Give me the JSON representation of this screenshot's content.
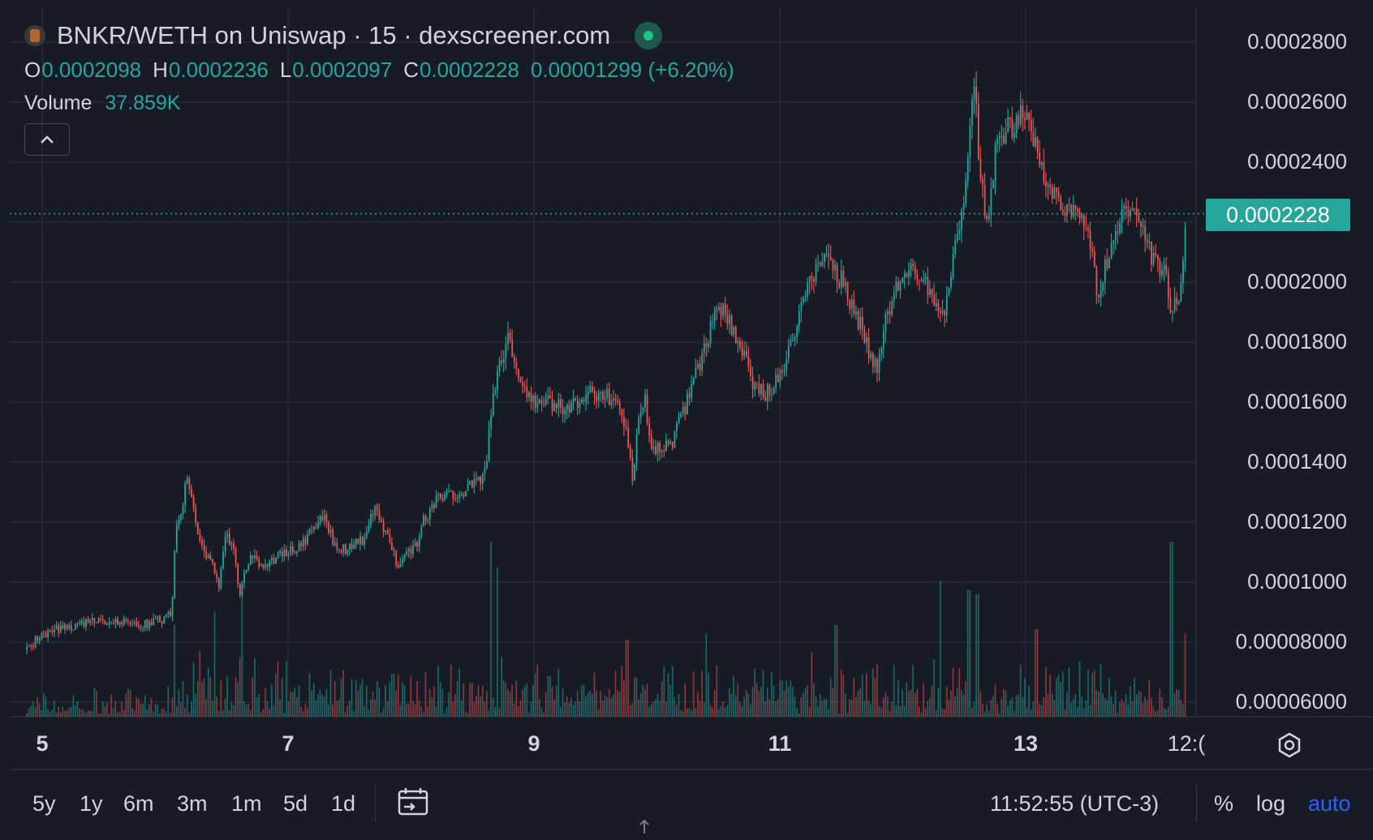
{
  "header": {
    "title": "BNKR/WETH on Uniswap · 15 · dexscreener.com",
    "ohlc": [
      {
        "key": "O",
        "value": "0.0002098"
      },
      {
        "key": "H",
        "value": "0.0002236"
      },
      {
        "key": "L",
        "value": "0.0002097"
      },
      {
        "key": "C",
        "value": "0.0002228"
      }
    ],
    "change": "0.00001299 (+6.20%)",
    "volume_label": "Volume",
    "volume_value": "37.859K"
  },
  "colors": {
    "up": "#26a69a",
    "down": "#ef5350",
    "background": "#171b26",
    "grid": "#262a36",
    "accent_blue": "#2962ff"
  },
  "price_axis": {
    "labels": [
      "0.0002800",
      "0.0002600",
      "0.0002400",
      "0.0002000",
      "0.0001800",
      "0.0001600",
      "0.0001400",
      "0.0001200",
      "0.0001000",
      "0.00008000",
      "0.00006000"
    ],
    "current_price": "0.0002228"
  },
  "time_axis": {
    "labels": [
      "5",
      "7",
      "9",
      "11",
      "13",
      "12:("
    ]
  },
  "bottom_bar": {
    "ranges": [
      "5y",
      "1y",
      "6m",
      "3m",
      "1m",
      "5d",
      "1d"
    ],
    "time": "11:52:55 (UTC-3)",
    "options": [
      "%",
      "log",
      "auto"
    ]
  },
  "chart_data": {
    "type": "candlestick",
    "title": "BNKR/WETH on Uniswap · 15 · dexscreener.com",
    "x_tick_labels": [
      "5",
      "7",
      "9",
      "11",
      "13",
      "12:("
    ],
    "y_tick_labels": [
      "0.0002800",
      "0.0002600",
      "0.0002400",
      "0.0002000",
      "0.0001800",
      "0.0001600",
      "0.0001400",
      "0.0001200",
      "0.0001000",
      "0.00008000",
      "0.00006000"
    ],
    "y_range": [
      5.75e-05,
      0.0002865
    ],
    "x_range_days": [
      4.85,
      14.3
    ],
    "current_price": 0.0002228,
    "grid": true,
    "price_path": [
      {
        "day": 4.87,
        "price": 7.73e-05
      },
      {
        "day": 4.95,
        "price": 8.12e-05
      },
      {
        "day": 5.1,
        "price": 8.42e-05
      },
      {
        "day": 5.3,
        "price": 8.6e-05
      },
      {
        "day": 5.5,
        "price": 8.72e-05
      },
      {
        "day": 5.7,
        "price": 8.62e-05
      },
      {
        "day": 5.85,
        "price": 8.6e-05
      },
      {
        "day": 5.97,
        "price": 8.75e-05
      },
      {
        "day": 6.05,
        "price": 8.92e-05
      },
      {
        "day": 6.08,
        "price": 0.000119
      },
      {
        "day": 6.13,
        "price": 0.000125
      },
      {
        "day": 6.17,
        "price": 0.0001345
      },
      {
        "day": 6.22,
        "price": 0.0001255
      },
      {
        "day": 6.3,
        "price": 0.00011
      },
      {
        "day": 6.37,
        "price": 0.000106
      },
      {
        "day": 6.43,
        "price": 9.9e-05
      },
      {
        "day": 6.48,
        "price": 0.000117
      },
      {
        "day": 6.55,
        "price": 0.00011
      },
      {
        "day": 6.6,
        "price": 9.6e-05
      },
      {
        "day": 6.68,
        "price": 0.000108
      },
      {
        "day": 6.8,
        "price": 0.000106
      },
      {
        "day": 6.95,
        "price": 0.000109
      },
      {
        "day": 7.1,
        "price": 0.000112
      },
      {
        "day": 7.2,
        "price": 0.000118
      },
      {
        "day": 7.3,
        "price": 0.000122
      },
      {
        "day": 7.35,
        "price": 0.000114
      },
      {
        "day": 7.45,
        "price": 0.000111
      },
      {
        "day": 7.6,
        "price": 0.000114
      },
      {
        "day": 7.7,
        "price": 0.000124
      },
      {
        "day": 7.8,
        "price": 0.000115
      },
      {
        "day": 7.88,
        "price": 0.000106
      },
      {
        "day": 7.95,
        "price": 0.00011
      },
      {
        "day": 8.05,
        "price": 0.000113
      },
      {
        "day": 8.1,
        "price": 0.000121
      },
      {
        "day": 8.2,
        "price": 0.000127
      },
      {
        "day": 8.35,
        "price": 0.00013
      },
      {
        "day": 8.5,
        "price": 0.000132
      },
      {
        "day": 8.6,
        "price": 0.000136
      },
      {
        "day": 8.65,
        "price": 0.00016
      },
      {
        "day": 8.72,
        "price": 0.000172
      },
      {
        "day": 8.78,
        "price": 0.0001835
      },
      {
        "day": 8.85,
        "price": 0.00017
      },
      {
        "day": 8.92,
        "price": 0.000166
      },
      {
        "day": 9.0,
        "price": 0.000159
      },
      {
        "day": 9.1,
        "price": 0.00016
      },
      {
        "day": 9.25,
        "price": 0.000158
      },
      {
        "day": 9.35,
        "price": 0.00016
      },
      {
        "day": 9.42,
        "price": 0.000164
      },
      {
        "day": 9.5,
        "price": 0.000161
      },
      {
        "day": 9.6,
        "price": 0.000162
      },
      {
        "day": 9.7,
        "price": 0.000158
      },
      {
        "day": 9.75,
        "price": 0.000148
      },
      {
        "day": 9.8,
        "price": 0.000134
      },
      {
        "day": 9.85,
        "price": 0.000156
      },
      {
        "day": 9.9,
        "price": 0.00016
      },
      {
        "day": 9.95,
        "price": 0.000144
      },
      {
        "day": 10.05,
        "price": 0.000145
      },
      {
        "day": 10.12,
        "price": 0.000147
      },
      {
        "day": 10.2,
        "price": 0.000155
      },
      {
        "day": 10.3,
        "price": 0.000168
      },
      {
        "day": 10.4,
        "price": 0.00018
      },
      {
        "day": 10.47,
        "price": 0.000193
      },
      {
        "day": 10.55,
        "price": 0.00019
      },
      {
        "day": 10.62,
        "price": 0.000183
      },
      {
        "day": 10.7,
        "price": 0.000176
      },
      {
        "day": 10.78,
        "price": 0.000164
      },
      {
        "day": 10.88,
        "price": 0.000163
      },
      {
        "day": 11.0,
        "price": 0.000169
      },
      {
        "day": 11.1,
        "price": 0.000182
      },
      {
        "day": 11.2,
        "price": 0.000196
      },
      {
        "day": 11.3,
        "price": 0.000206
      },
      {
        "day": 11.4,
        "price": 0.000207
      },
      {
        "day": 11.5,
        "price": 0.0002
      },
      {
        "day": 11.6,
        "price": 0.000191
      },
      {
        "day": 11.7,
        "price": 0.00018
      },
      {
        "day": 11.78,
        "price": 0.00017
      },
      {
        "day": 11.85,
        "price": 0.000186
      },
      {
        "day": 11.95,
        "price": 0.0002
      },
      {
        "day": 12.05,
        "price": 0.000206
      },
      {
        "day": 12.15,
        "price": 0.000202
      },
      {
        "day": 12.25,
        "price": 0.000191
      },
      {
        "day": 12.35,
        "price": 0.000192
      },
      {
        "day": 12.42,
        "price": 0.00021
      },
      {
        "day": 12.5,
        "price": 0.000229
      },
      {
        "day": 12.55,
        "price": 0.000255
      },
      {
        "day": 12.58,
        "price": 0.000266
      },
      {
        "day": 12.62,
        "price": 0.000236
      },
      {
        "day": 12.68,
        "price": 0.000218
      },
      {
        "day": 12.75,
        "price": 0.000245
      },
      {
        "day": 12.8,
        "price": 0.00025
      },
      {
        "day": 12.9,
        "price": 0.000253
      },
      {
        "day": 13.0,
        "price": 0.000257
      },
      {
        "day": 13.05,
        "price": 0.000246
      },
      {
        "day": 13.12,
        "price": 0.00024
      },
      {
        "day": 13.2,
        "price": 0.00023
      },
      {
        "day": 13.3,
        "price": 0.000226
      },
      {
        "day": 13.4,
        "price": 0.000225
      },
      {
        "day": 13.5,
        "price": 0.000216
      },
      {
        "day": 13.58,
        "price": 0.000196
      },
      {
        "day": 13.65,
        "price": 0.000206
      },
      {
        "day": 13.72,
        "price": 0.000214
      },
      {
        "day": 13.8,
        "price": 0.000224
      },
      {
        "day": 13.9,
        "price": 0.000221
      },
      {
        "day": 13.98,
        "price": 0.000212
      },
      {
        "day": 14.05,
        "price": 0.000206
      },
      {
        "day": 14.12,
        "price": 0.000205
      },
      {
        "day": 14.18,
        "price": 0.000189
      },
      {
        "day": 14.22,
        "price": 0.000193
      },
      {
        "day": 14.27,
        "price": 0.000201
      },
      {
        "day": 14.3,
        "price": 0.0002228
      }
    ],
    "volume_spikes": [
      {
        "day": 6.07,
        "relative": 0.42
      },
      {
        "day": 6.28,
        "relative": 0.3
      },
      {
        "day": 6.4,
        "relative": 0.48
      },
      {
        "day": 6.62,
        "relative": 0.55
      },
      {
        "day": 8.65,
        "relative": 0.8
      },
      {
        "day": 8.7,
        "relative": 0.68
      },
      {
        "day": 9.75,
        "relative": 0.35
      },
      {
        "day": 10.4,
        "relative": 0.38
      },
      {
        "day": 11.45,
        "relative": 0.42
      },
      {
        "day": 12.3,
        "relative": 0.62
      },
      {
        "day": 12.53,
        "relative": 0.58
      },
      {
        "day": 12.6,
        "relative": 0.56
      },
      {
        "day": 13.08,
        "relative": 0.4
      },
      {
        "day": 14.18,
        "relative": 0.8
      },
      {
        "day": 14.29,
        "relative": 0.38
      }
    ]
  }
}
